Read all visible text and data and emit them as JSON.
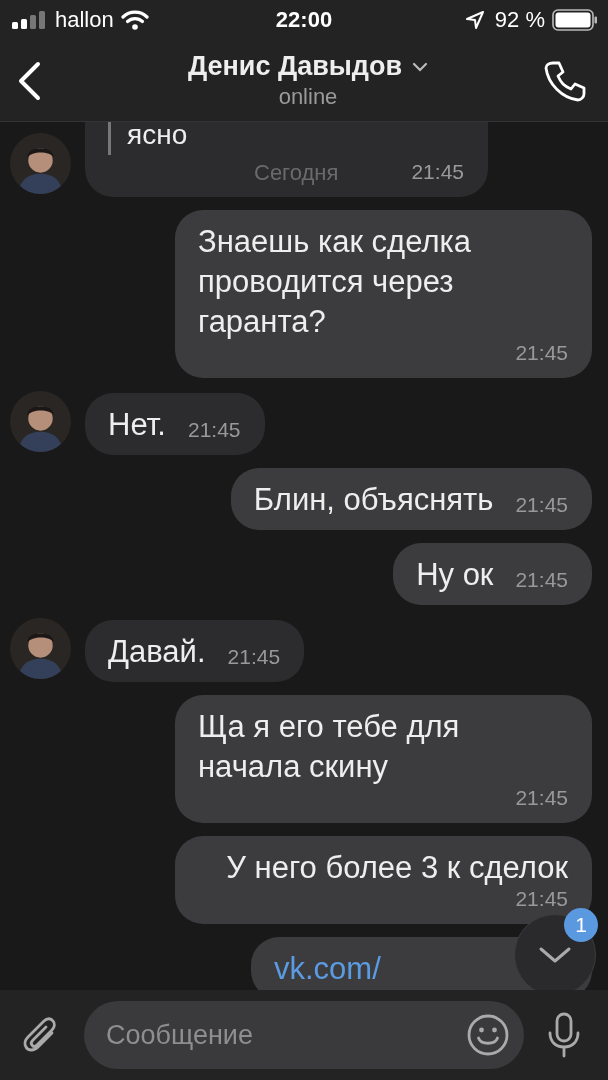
{
  "status_bar": {
    "carrier": "hallon",
    "time": "22:00",
    "battery": "92 %"
  },
  "header": {
    "title": "Денис Давыдов",
    "subtitle": "online"
  },
  "date_label": "Сегодня",
  "messages": [
    {
      "outgoing": false,
      "kind": "reply",
      "quote": "ясно",
      "time": "21:45"
    },
    {
      "outgoing": true,
      "kind": "text",
      "text": "Знаешь как сделка проводится через гаранта?",
      "time": "21:45"
    },
    {
      "outgoing": false,
      "kind": "text",
      "text": "Нет.",
      "time": "21:45"
    },
    {
      "outgoing": true,
      "kind": "text",
      "text": "Блин, объяснять",
      "time": "21:45"
    },
    {
      "outgoing": true,
      "kind": "text",
      "text": "Ну ок",
      "time": "21:45"
    },
    {
      "outgoing": false,
      "kind": "text",
      "text": "Давай.",
      "time": "21:45"
    },
    {
      "outgoing": true,
      "kind": "text",
      "text": "Ща я его тебе для начала скину",
      "time": "21:45"
    },
    {
      "outgoing": true,
      "kind": "text",
      "text": "У него более 3 к сделок",
      "time": "21:45"
    },
    {
      "outgoing": true,
      "kind": "link",
      "text": "vk.com/"
    }
  ],
  "scroll_button": {
    "badge": "1"
  },
  "composer": {
    "placeholder": "Сообщение"
  }
}
